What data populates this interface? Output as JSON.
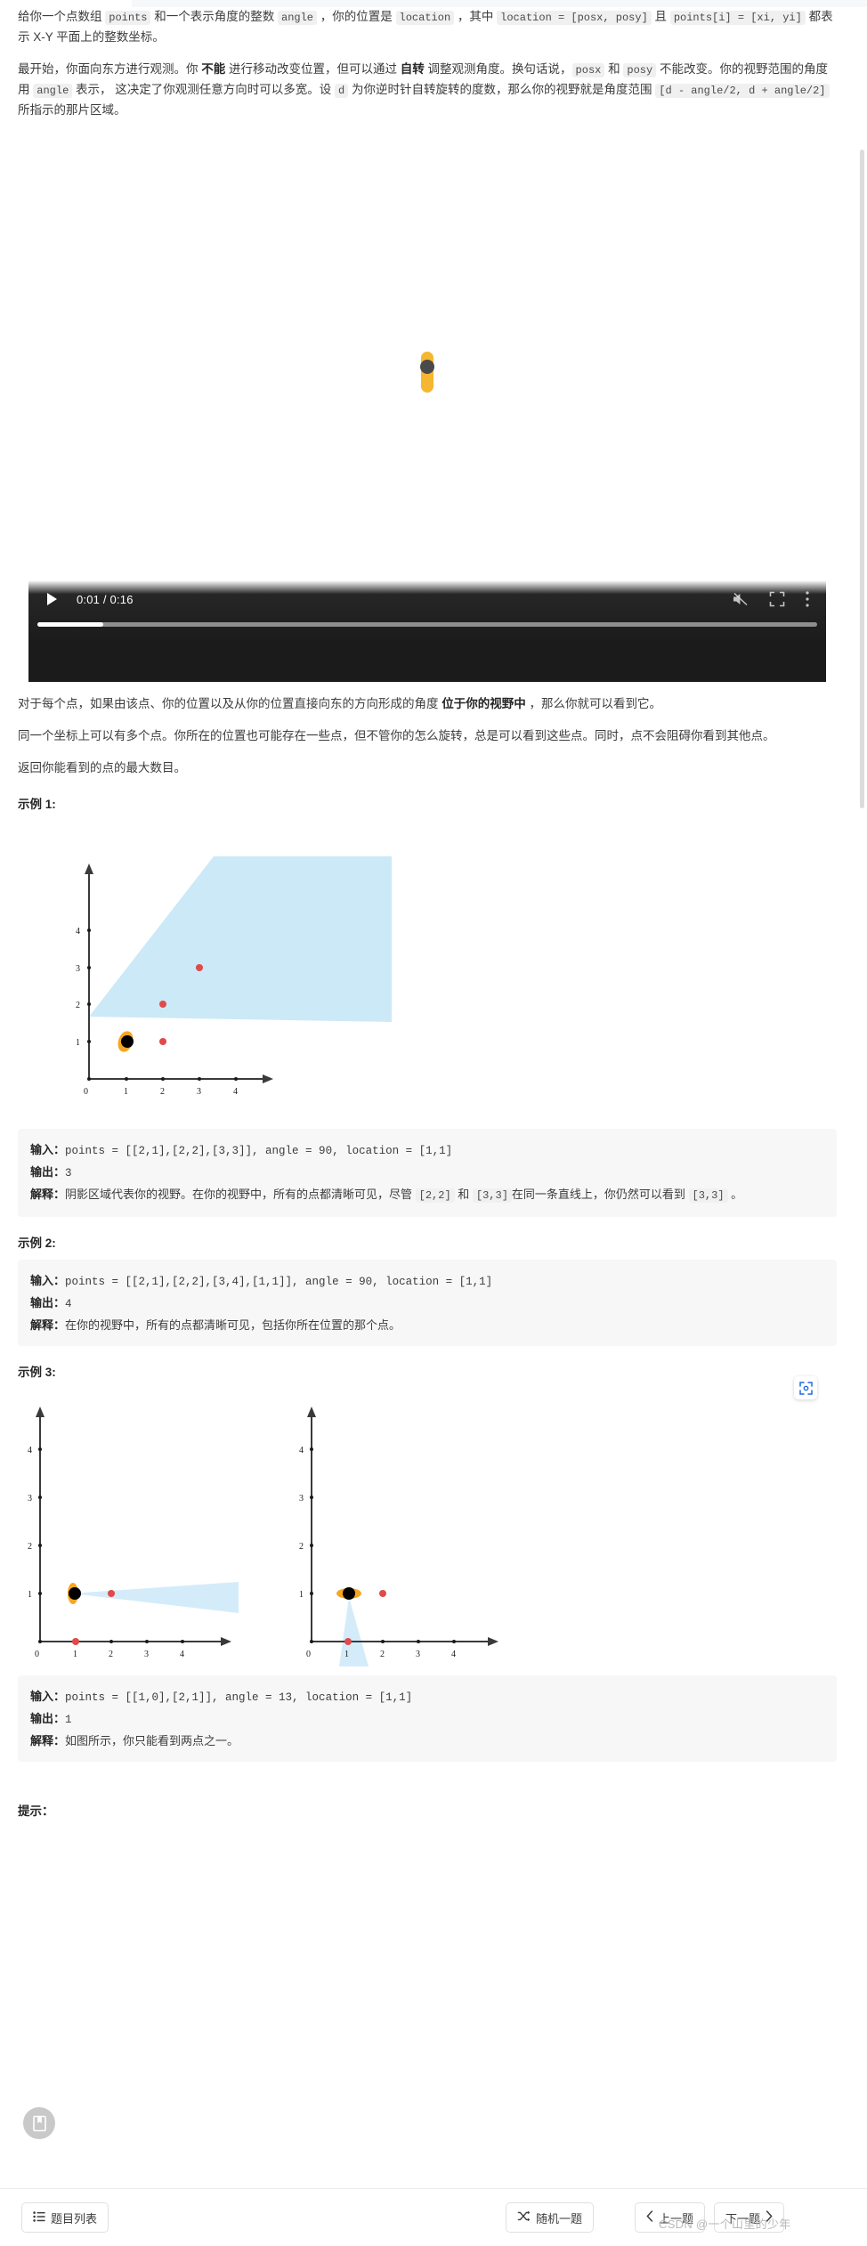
{
  "problem": {
    "paragraph1_parts": [
      {
        "t": "text",
        "v": "给你一个点数组 "
      },
      {
        "t": "code",
        "v": "points"
      },
      {
        "t": "text",
        "v": " 和一个表示角度的整数 "
      },
      {
        "t": "code",
        "v": "angle"
      },
      {
        "t": "text",
        "v": " ，你的位置是 "
      },
      {
        "t": "code",
        "v": "location"
      },
      {
        "t": "text",
        "v": " ，其中 "
      },
      {
        "t": "code",
        "v": "location = [posx, posy]"
      },
      {
        "t": "text",
        "v": " 且 "
      },
      {
        "t": "code",
        "v": "points[i] = [xi, yi]"
      },
      {
        "t": "text",
        "v": " 都表示 X-Y 平面上的整数坐标。"
      }
    ],
    "paragraph2_parts": [
      {
        "t": "text",
        "v": "最开始，你面向东方进行观测。你 "
      },
      {
        "t": "bold",
        "v": "不能"
      },
      {
        "t": "text",
        "v": " 进行移动改变位置，但可以通过 "
      },
      {
        "t": "bold",
        "v": "自转"
      },
      {
        "t": "text",
        "v": " 调整观测角度。换句话说，"
      },
      {
        "t": "code",
        "v": "posx"
      },
      {
        "t": "text",
        "v": " 和 "
      },
      {
        "t": "code",
        "v": "posy"
      },
      {
        "t": "text",
        "v": " 不能改变。你的视野范围的角度用 "
      },
      {
        "t": "code",
        "v": "angle"
      },
      {
        "t": "text",
        "v": " 表示， 这决定了你观测任意方向时可以多宽。设 "
      },
      {
        "t": "code",
        "v": "d"
      },
      {
        "t": "text",
        "v": " 为你逆时针自转旋转的度数，那么你的视野就是角度范围 "
      },
      {
        "t": "code",
        "v": "[d - angle/2, d + angle/2]"
      },
      {
        "t": "text",
        "v": " 所指示的那片区域。"
      }
    ],
    "paragraph3_parts": [
      {
        "t": "text",
        "v": "对于每个点，如果由该点、你的位置以及从你的位置直接向东的方向形成的角度 "
      },
      {
        "t": "bold",
        "v": "位于你的视野中"
      },
      {
        "t": "text",
        "v": " ，那么你就可以看到它。"
      }
    ],
    "paragraph4": "同一个坐标上可以有多个点。你所在的位置也可能存在一些点，但不管你的怎么旋转，总是可以看到这些点。同时，点不会阻碍你看到其他点。",
    "paragraph5": "返回你能看到的点的最大数目。"
  },
  "video": {
    "current_time": "0:01",
    "duration": "0:16",
    "time_display": "0:01 / 0:16",
    "progress_percent": 8.5,
    "play_icon": "play-icon",
    "mute_icon": "mute-icon",
    "fullscreen_icon": "fullscreen-icon",
    "more_icon": "more-options-icon"
  },
  "examples": [
    {
      "title": "示例 1:",
      "input_label": "输入：",
      "input_value": "points = [[2,1],[2,2],[3,3]], angle = 90, location = [1,1]",
      "output_label": "输出：",
      "output_value": "3",
      "explain_label": "解释：",
      "explain_parts": [
        {
          "t": "text",
          "v": "阴影区域代表你的视野。在你的视野中，所有的点都清晰可见，尽管 "
        },
        {
          "t": "code",
          "v": "[2,2]"
        },
        {
          "t": "text",
          "v": " 和 "
        },
        {
          "t": "code",
          "v": "[3,3]"
        },
        {
          "t": "text",
          "v": "在同一条直线上，你仍然可以看到 "
        },
        {
          "t": "code",
          "v": "[3,3]"
        },
        {
          "t": "text",
          "v": " 。"
        }
      ]
    },
    {
      "title": "示例 2:",
      "input_label": "输入：",
      "input_value": "points = [[2,1],[2,2],[3,4],[1,1]], angle = 90, location = [1,1]",
      "output_label": "输出：",
      "output_value": "4",
      "explain_label": "解释：",
      "explain_parts": [
        {
          "t": "text",
          "v": "在你的视野中，所有的点都清晰可见，包括你所在位置的那个点。"
        }
      ]
    },
    {
      "title": "示例 3:",
      "input_label": "输入：",
      "input_value": "points = [[1,0],[2,1]], angle = 13, location = [1,1]",
      "output_label": "输出：",
      "output_value": "1",
      "explain_label": "解释：",
      "explain_parts": [
        {
          "t": "text",
          "v": "如图所示，你只能看到两点之一。"
        }
      ]
    }
  ],
  "chart_data": [
    {
      "type": "scatter",
      "name": "example-1-figure",
      "title": "",
      "xlabel": "",
      "ylabel": "",
      "xlim": [
        0,
        4.4
      ],
      "ylim": [
        0,
        4.4
      ],
      "xticks": [
        0,
        1,
        2,
        3,
        4
      ],
      "yticks": [
        0,
        1,
        2,
        3,
        4
      ],
      "grid": false,
      "observer": {
        "x": 1,
        "y": 1,
        "color": "#000000",
        "highlight_color": "#f5a623"
      },
      "points": [
        {
          "x": 2,
          "y": 1,
          "color": "#e04a4a"
        },
        {
          "x": 2,
          "y": 2,
          "color": "#e04a4a"
        },
        {
          "x": 3,
          "y": 3,
          "color": "#e04a4a"
        }
      ],
      "view_cone": {
        "angle": 90,
        "fill": "#cce9f7",
        "description": "90度视野扇形从 [1,1] 向东北覆盖所有点"
      }
    },
    {
      "type": "scatter",
      "name": "example-3-figure-left",
      "title": "",
      "xlabel": "",
      "ylabel": "",
      "xlim": [
        0,
        4.4
      ],
      "ylim": [
        0,
        4.4
      ],
      "xticks": [
        0,
        1,
        2,
        3,
        4
      ],
      "yticks": [
        0,
        1,
        2,
        3,
        4
      ],
      "grid": false,
      "observer": {
        "x": 1,
        "y": 1,
        "color": "#000000",
        "highlight_color": "#f5a623"
      },
      "points": [
        {
          "x": 2,
          "y": 1,
          "color": "#e04a4a"
        },
        {
          "x": 1,
          "y": 0,
          "color": "#e04a4a"
        }
      ],
      "view_cone": {
        "angle": 13,
        "fill": "#d4ecfa",
        "description": "13度视野朝东，只看到 [2,1]"
      }
    },
    {
      "type": "scatter",
      "name": "example-3-figure-right",
      "title": "",
      "xlabel": "",
      "ylabel": "",
      "xlim": [
        0,
        4.4
      ],
      "ylim": [
        0,
        4.4
      ],
      "xticks": [
        0,
        1,
        2,
        3,
        4
      ],
      "yticks": [
        0,
        1,
        2,
        3,
        4
      ],
      "grid": false,
      "observer": {
        "x": 1,
        "y": 1,
        "color": "#000000",
        "highlight_color": "#f5a623"
      },
      "points": [
        {
          "x": 2,
          "y": 1,
          "color": "#e04a4a"
        },
        {
          "x": 1,
          "y": 0,
          "color": "#e04a4a"
        }
      ],
      "view_cone": {
        "angle": 13,
        "fill": "#d4ecfa",
        "description": "13度视野朝南，只看到 [1,0]"
      }
    }
  ],
  "hints": {
    "title": "提示："
  },
  "bottombar": {
    "list_label": "题目列表",
    "list_icon": "list-icon",
    "random_label": "随机一题",
    "random_icon": "shuffle-icon",
    "prev_label": "上一题",
    "prev_icon": "chevron-left-icon",
    "next_label": "下一题",
    "next_icon": "chevron-right-icon"
  },
  "watermark": {
    "text": "CSDN @一个山里的少年"
  },
  "fab": {
    "icon": "bookmark-icon"
  },
  "colors": {
    "point_red": "#e04a4a",
    "observer_black": "#000000",
    "observer_orange": "#f5a623",
    "cone_blue": "#cce9f7",
    "code_bg": "#f7f7f7"
  }
}
